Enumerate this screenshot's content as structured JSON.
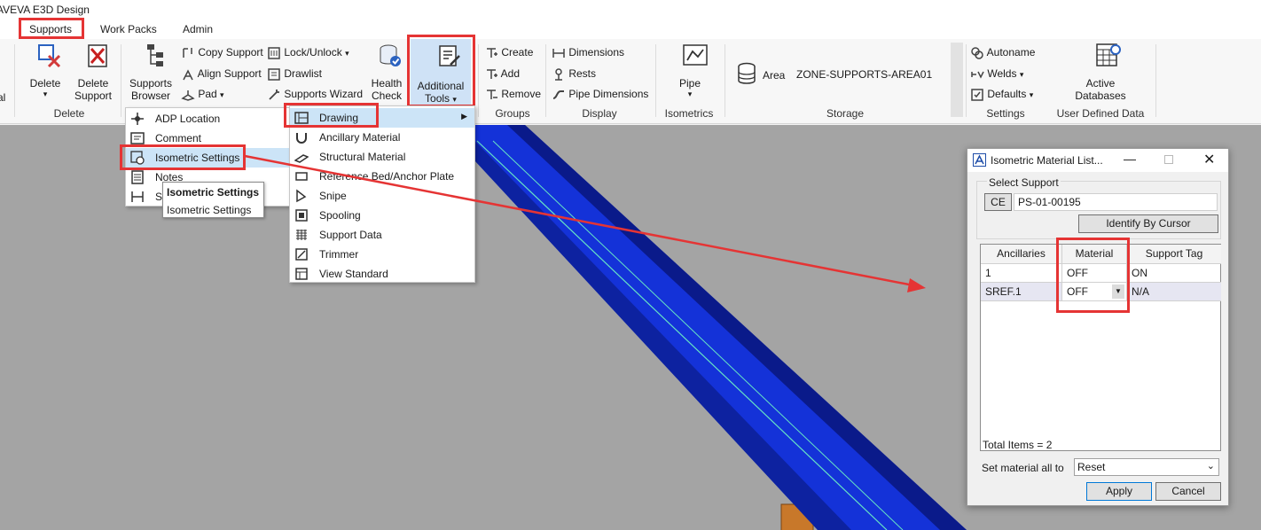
{
  "app": {
    "title": "AVEVA E3D Design"
  },
  "tabs": [
    {
      "label": "Supports"
    },
    {
      "label": "Work Packs"
    },
    {
      "label": "Admin"
    }
  ],
  "ribbon": {
    "partial_left_label": "al",
    "delete": {
      "label": "Delete",
      "support_label_1": "Delete",
      "support_label_2": "Support",
      "group": "Delete"
    },
    "supports_browser": {
      "line1": "Supports",
      "line2": "Browser"
    },
    "small_col1": [
      "Copy Support",
      "Align Support",
      "Pad"
    ],
    "small_col2": [
      "Lock/Unlock",
      "Drawlist",
      "Supports Wizard"
    ],
    "health_check": {
      "line1": "Health",
      "line2": "Check"
    },
    "additional_tools": {
      "line1": "Additional",
      "line2": "Tools"
    },
    "groups": {
      "items": [
        "Create",
        "Add",
        "Remove"
      ],
      "label": "Groups"
    },
    "display": {
      "items": [
        "Dimensions",
        "Rests",
        "Pipe Dimensions"
      ],
      "label": "Display"
    },
    "isometrics": {
      "pipe_label": "Pipe",
      "label": "Isometrics"
    },
    "storage": {
      "area_label": "Area",
      "area_value": "ZONE-SUPPORTS-AREA01",
      "label": "Storage"
    },
    "settings": {
      "items": [
        "Autoname",
        "Welds",
        "Defaults"
      ],
      "label": "Settings"
    },
    "user_defined": {
      "line1": "Active",
      "line2": "Databases",
      "label": "User Defined Data"
    }
  },
  "left_menu": {
    "items": [
      "ADP Location",
      "Comment",
      "Isometric Settings",
      "Notes",
      "Sp"
    ],
    "tooltip_title": "Isometric Settings",
    "tooltip_body": "Isometric Settings"
  },
  "drawing_menu": {
    "items": [
      "Drawing",
      "Ancillary Material",
      "Structural Material",
      "Reference Bed/Anchor Plate",
      "Snipe",
      "Spooling",
      "Support Data",
      "Trimmer",
      "View Standard"
    ]
  },
  "dialog": {
    "title": "Isometric Material List...",
    "select_support_label": "Select Support",
    "ce_label": "CE",
    "support_value": "PS-01-00195",
    "identify_button": "Identify By Cursor",
    "columns": [
      "Ancillaries",
      "Material",
      "Support Tag"
    ],
    "rows": [
      {
        "ancillary": "1",
        "material": "OFF",
        "tag": "ON"
      },
      {
        "ancillary": "SREF.1",
        "material": "OFF",
        "tag": "N/A"
      }
    ],
    "total_items": "Total Items = 2",
    "set_material_label": "Set material all to",
    "set_material_value": "Reset",
    "apply_button": "Apply",
    "cancel_button": "Cancel"
  },
  "colors": {
    "accent": "#2b62c0",
    "highlight_red": "#e53434",
    "pipe_blue": "#1230d8",
    "viewport_gray": "#a4a4a4"
  }
}
